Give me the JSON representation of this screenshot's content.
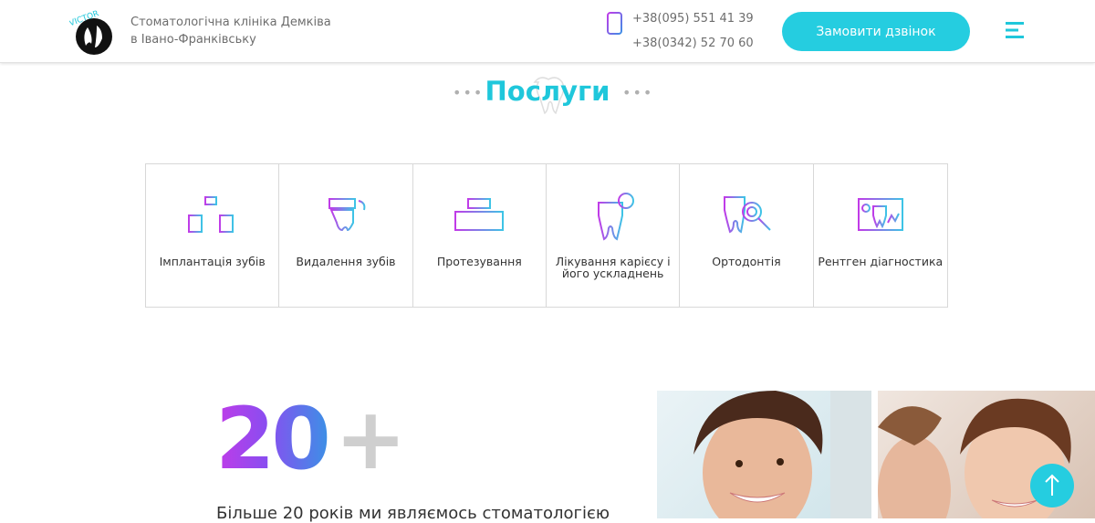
{
  "header": {
    "logo_text": "VICTOR",
    "clinic_line1": "Стоматологічна клініка Демківа",
    "clinic_line2": "в Івано-Франківську",
    "phone1": "+38(095) 551 41 39",
    "phone2": "+38(0342) 52 70 60",
    "call_button": "Замовити дзвінок"
  },
  "services_section": {
    "title": "Послуги",
    "items": [
      {
        "label": "Імплантація зубів",
        "icon": "implant-icon"
      },
      {
        "label": "Видалення зубів",
        "icon": "tooth-extraction-icon"
      },
      {
        "label": "Протезування",
        "icon": "prosthetics-icon"
      },
      {
        "label": "Лікування карієсу і його ускладнень",
        "icon": "caries-treatment-icon"
      },
      {
        "label": "Ортодонтія",
        "icon": "orthodontics-icon"
      },
      {
        "label": "Рентген діагностика",
        "icon": "xray-icon"
      }
    ]
  },
  "stats": {
    "number": "20",
    "plus": "+",
    "text": "Більше 20 років ми являємось стоматологією"
  },
  "colors": {
    "accent": "#25cde0",
    "gradient_start": "#c13be8",
    "gradient_end": "#3d8fe6"
  }
}
